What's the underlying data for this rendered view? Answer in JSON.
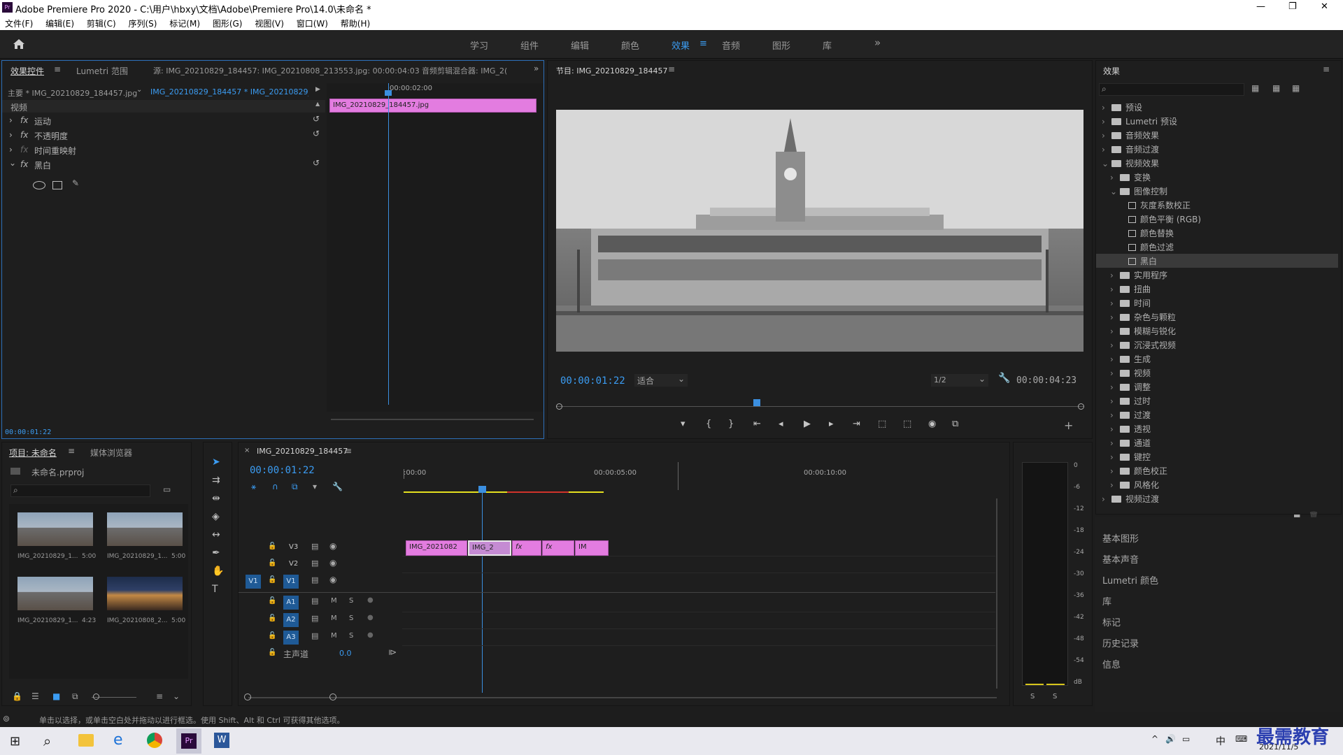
{
  "window": {
    "title": "Adobe Premiere Pro 2020 - C:\\用户\\hbxy\\文档\\Adobe\\Premiere Pro\\14.0\\未命名 *",
    "controls": [
      "—",
      "❐",
      "✕"
    ]
  },
  "menu": [
    "文件(F)",
    "编辑(E)",
    "剪辑(C)",
    "序列(S)",
    "标记(M)",
    "图形(G)",
    "视图(V)",
    "窗口(W)",
    "帮助(H)"
  ],
  "workspaces": {
    "items": [
      "学习",
      "组件",
      "编辑",
      "颜色",
      "效果",
      "音频",
      "图形",
      "库"
    ],
    "active": "效果",
    "more": "»"
  },
  "effect_controls": {
    "tabs": [
      "效果控件",
      "Lumetri 范围",
      "源: IMG_20210829_184457: IMG_20210808_213553.jpg: 00:00:04:03",
      "音频剪辑混合器: IMG_2("
    ],
    "master": "主要 * IMG_20210829_184457.jpg",
    "sequence": "IMG_20210829_184457 * IMG_20210829_...",
    "ruler_time": "00:00:02:00",
    "clip_label": "IMG_20210829_184457.jpg",
    "section": "视频",
    "properties": [
      "运动",
      "不透明度",
      "时间重映射",
      "黑白"
    ],
    "timecode": "00:00:01:22"
  },
  "program": {
    "title": "节目: IMG_20210829_184457",
    "timecode": "00:00:01:22",
    "fit": "适合",
    "quality": "1/2",
    "duration": "00:00:04:23"
  },
  "effects_panel": {
    "title": "效果",
    "search_placeholder": "",
    "tree": [
      {
        "label": "预设",
        "level": 0,
        "type": "folder",
        "open": false
      },
      {
        "label": "Lumetri 预设",
        "level": 0,
        "type": "folder",
        "open": false
      },
      {
        "label": "音频效果",
        "level": 0,
        "type": "folder",
        "open": false
      },
      {
        "label": "音频过渡",
        "level": 0,
        "type": "folder",
        "open": false
      },
      {
        "label": "视频效果",
        "level": 0,
        "type": "folder",
        "open": true
      },
      {
        "label": "变换",
        "level": 1,
        "type": "folder",
        "open": false
      },
      {
        "label": "图像控制",
        "level": 1,
        "type": "folder",
        "open": true
      },
      {
        "label": "灰度系数校正",
        "level": 2,
        "type": "fx"
      },
      {
        "label": "颜色平衡 (RGB)",
        "level": 2,
        "type": "fx"
      },
      {
        "label": "颜色替换",
        "level": 2,
        "type": "fx"
      },
      {
        "label": "颜色过滤",
        "level": 2,
        "type": "fx"
      },
      {
        "label": "黑白",
        "level": 2,
        "type": "fx",
        "selected": true
      },
      {
        "label": "实用程序",
        "level": 1,
        "type": "folder",
        "open": false
      },
      {
        "label": "扭曲",
        "level": 1,
        "type": "folder",
        "open": false
      },
      {
        "label": "时间",
        "level": 1,
        "type": "folder",
        "open": false
      },
      {
        "label": "杂色与颗粒",
        "level": 1,
        "type": "folder",
        "open": false
      },
      {
        "label": "模糊与锐化",
        "level": 1,
        "type": "folder",
        "open": false
      },
      {
        "label": "沉浸式视频",
        "level": 1,
        "type": "folder",
        "open": false
      },
      {
        "label": "生成",
        "level": 1,
        "type": "folder",
        "open": false
      },
      {
        "label": "视频",
        "level": 1,
        "type": "folder",
        "open": false
      },
      {
        "label": "调整",
        "level": 1,
        "type": "folder",
        "open": false
      },
      {
        "label": "过时",
        "level": 1,
        "type": "folder",
        "open": false
      },
      {
        "label": "过渡",
        "level": 1,
        "type": "folder",
        "open": false
      },
      {
        "label": "透视",
        "level": 1,
        "type": "folder",
        "open": false
      },
      {
        "label": "通道",
        "level": 1,
        "type": "folder",
        "open": false
      },
      {
        "label": "键控",
        "level": 1,
        "type": "folder",
        "open": false
      },
      {
        "label": "颜色校正",
        "level": 1,
        "type": "folder",
        "open": false
      },
      {
        "label": "风格化",
        "level": 1,
        "type": "folder",
        "open": false
      },
      {
        "label": "视频过渡",
        "level": 0,
        "type": "folder",
        "open": false
      }
    ],
    "sections": [
      "基本图形",
      "基本声音",
      "Lumetri 颜色",
      "库",
      "标记",
      "历史记录",
      "信息"
    ]
  },
  "project": {
    "tabs": [
      "项目: 未命名",
      "媒体浏览器"
    ],
    "file": "未命名.prproj",
    "items": [
      {
        "name": "IMG_20210829_1...",
        "duration": "5:00"
      },
      {
        "name": "IMG_20210829_1...",
        "duration": "5:00"
      },
      {
        "name": "IMG_20210829_1...",
        "duration": "4:23"
      },
      {
        "name": "IMG_20210808_2...",
        "duration": "5:00"
      }
    ]
  },
  "timeline": {
    "tab": "IMG_20210829_184457",
    "timecode": "00:00:01:22",
    "ruler": [
      ":00:00",
      "00:00:05:00",
      "00:00:10:00"
    ],
    "tracks_video": [
      "V3",
      "V2",
      "V1"
    ],
    "tracks_audio": [
      "A1",
      "A2",
      "A3"
    ],
    "source_patch": "V1",
    "master_label": "主声道",
    "master_value": "0.0",
    "clips": [
      "IMG_2021082",
      "IMG_2",
      "fx",
      "fx",
      "IM"
    ]
  },
  "meter": {
    "scale": [
      "0",
      "-6",
      "-12",
      "-18",
      "-24",
      "-30",
      "-36",
      "-42",
      "-48",
      "-54",
      "dB"
    ],
    "solo": [
      "S",
      "S"
    ]
  },
  "status": "单击以选择，或单击空白处并拖动以进行框选。使用 Shift、Alt 和 Ctrl 可获得其他选项。",
  "taskbar": {
    "ime": "中",
    "date": "2021/11/5",
    "watermark": "最需教育"
  }
}
